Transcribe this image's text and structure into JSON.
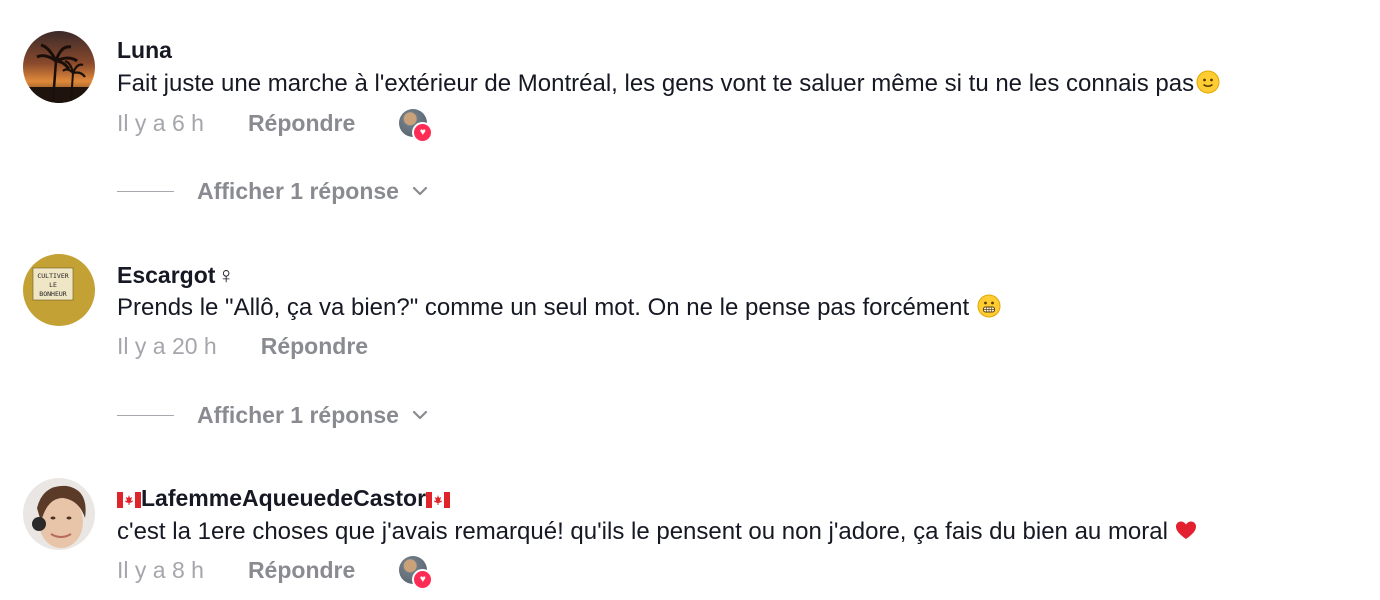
{
  "comments": [
    {
      "username": "Luna",
      "text": "Fait juste une marche à l'extérieur de Montréal, les gens vont te saluer même si tu ne les connais pas",
      "emoji_icon": "slightly-smiling-face-emoji",
      "time": "Il y a 6 h",
      "reply_label": "Répondre",
      "liked_by_creator": true,
      "view_replies": "Afficher 1 réponse"
    },
    {
      "username": "Escargot",
      "username_suffix": "♀",
      "text": "Prends le \"Allô, ça va bien?\" comme un seul mot. On ne le pense pas forcément",
      "emoji_icon": "grimacing-face-emoji",
      "time": "Il y a 20 h",
      "reply_label": "Répondre",
      "liked_by_creator": false,
      "view_replies": "Afficher 1 réponse",
      "avatar_text": [
        "CULTIVER",
        "LE",
        "BONHEUR"
      ]
    },
    {
      "username": "LafemmeAqueuedeCastor",
      "username_flags": "canada-flag-icon",
      "text": "c'est la 1ere choses que j'avais remarqué! qu'ils le pensent ou non j'adore, ça fais du bien au moral",
      "emoji_icon": "red-heart-emoji",
      "time": "Il y a 8 h",
      "reply_label": "Répondre",
      "liked_by_creator": true
    }
  ],
  "colors": {
    "text": "#161823",
    "secondary": "#8a8b91",
    "like_badge": "#fe2c55"
  }
}
